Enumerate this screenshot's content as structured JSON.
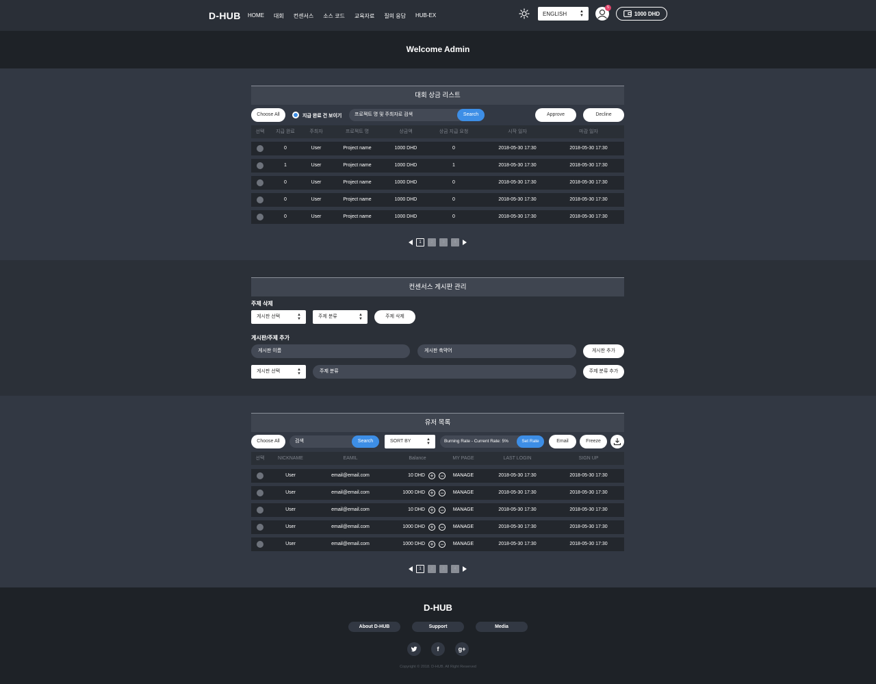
{
  "header": {
    "logo": "D-HUB",
    "nav": [
      "HOME",
      "대회",
      "컨센서스",
      "소스 코드",
      "교육자료",
      "질의 응답",
      "HUB-EX"
    ],
    "language": "ENGLISH",
    "notification_count": "5",
    "wallet_balance": "1000 DHD"
  },
  "welcome": "Welcome Admin",
  "prize_list": {
    "title": "대회 상금 리스트",
    "choose_all": "Choose All",
    "toggle_label": "지급 완료 건 보이기",
    "search_placeholder": "프로젝트 명 및 주최자로 검색",
    "search_button": "Search",
    "approve": "Approve",
    "decline": "Decline",
    "columns": [
      "선택",
      "지급 완료",
      "주최자",
      "프로젝트 명",
      "상금액",
      "상금 지급 요청",
      "시작 일자",
      "마감 일자"
    ],
    "rows": [
      {
        "paid": "0",
        "host": "User",
        "project": "Project name",
        "prize": "1000 DHD",
        "request": "0",
        "start": "2018-05-30 17:30",
        "end": "2018-05-30 17:30"
      },
      {
        "paid": "1",
        "host": "User",
        "project": "Project name",
        "prize": "1000 DHD",
        "request": "1",
        "start": "2018-05-30 17:30",
        "end": "2018-05-30 17:30"
      },
      {
        "paid": "0",
        "host": "User",
        "project": "Project name",
        "prize": "1000 DHD",
        "request": "0",
        "start": "2018-05-30 17:30",
        "end": "2018-05-30 17:30"
      },
      {
        "paid": "0",
        "host": "User",
        "project": "Project name",
        "prize": "1000 DHD",
        "request": "0",
        "start": "2018-05-30 17:30",
        "end": "2018-05-30 17:30"
      },
      {
        "paid": "0",
        "host": "User",
        "project": "Project name",
        "prize": "1000 DHD",
        "request": "0",
        "start": "2018-05-30 17:30",
        "end": "2018-05-30 17:30"
      }
    ],
    "pages": [
      "1",
      "2",
      "3",
      "4"
    ]
  },
  "consensus": {
    "title": "컨센서스 게시판 관리",
    "delete_label": "주제 삭제",
    "board_select": "게시판 선택",
    "topic_select": "주제 분류",
    "delete_button": "주제 삭제",
    "add_label": "게시판/주제 추가",
    "board_name_placeholder": "게시판 이름",
    "board_abbr_placeholder": "게시판 축약어",
    "add_board_button": "게시판 추가",
    "board_select2": "게시판 선택",
    "topic_placeholder": "주제 분류",
    "add_topic_button": "주제 분류 추가"
  },
  "users": {
    "title": "유저 목록",
    "choose_all": "Choose All",
    "search_placeholder": "검색",
    "search_button": "Search",
    "sort_by": "SORT BY",
    "burning_rate": "Burning Rate - Current Rate: 5%",
    "set_rate": "Set Rate",
    "email": "Email",
    "freeze": "Freeze",
    "columns": [
      "선택",
      "NICKNAME",
      "EAMIL",
      "Balance",
      "MY PAGE",
      "LAST LOGIN",
      "SIGN UP"
    ],
    "rows": [
      {
        "nickname": "User",
        "email": "email@email.com",
        "balance": "10 DHD",
        "mypage": "MANAGE",
        "last_login": "2018-05-30 17:30",
        "sign_up": "2018-05-30 17:30"
      },
      {
        "nickname": "User",
        "email": "email@email.com",
        "balance": "1000 DHD",
        "mypage": "MANAGE",
        "last_login": "2018-05-30 17:30",
        "sign_up": "2018-05-30 17:30"
      },
      {
        "nickname": "User",
        "email": "email@email.com",
        "balance": "10 DHD",
        "mypage": "MANAGE",
        "last_login": "2018-05-30 17:30",
        "sign_up": "2018-05-30 17:30"
      },
      {
        "nickname": "User",
        "email": "email@email.com",
        "balance": "1000 DHD",
        "mypage": "MANAGE",
        "last_login": "2018-05-30 17:30",
        "sign_up": "2018-05-30 17:30"
      },
      {
        "nickname": "User",
        "email": "email@email.com",
        "balance": "1000 DHD",
        "mypage": "MANAGE",
        "last_login": "2018-05-30 17:30",
        "sign_up": "2018-05-30 17:30"
      }
    ],
    "pages": [
      "1",
      "2",
      "3",
      "4"
    ]
  },
  "footer": {
    "logo": "D-HUB",
    "links": [
      "About D-HUB",
      "Support",
      "Media"
    ],
    "social": [
      "twitter-icon",
      "facebook-icon",
      "google-plus-icon"
    ],
    "copyright": "Copyright © 2018. D-HUB. All Right Reserved"
  },
  "colors": {
    "accent": "#3d8ee6",
    "badge": "#e0446a"
  }
}
